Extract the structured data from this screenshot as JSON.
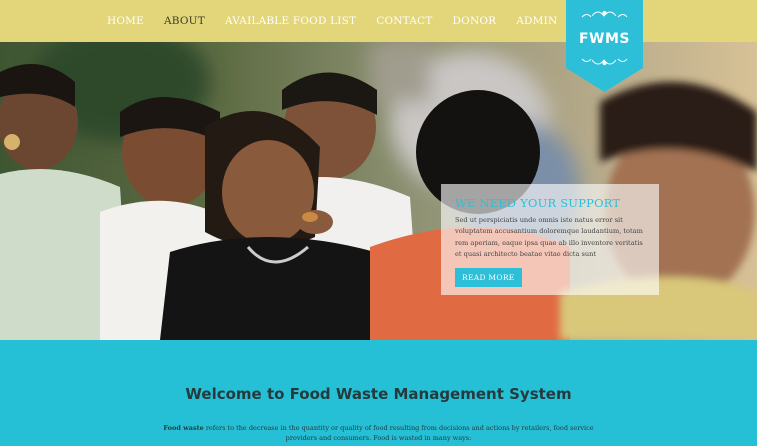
{
  "nav": {
    "items": [
      {
        "label": "HOME",
        "active": false
      },
      {
        "label": "ABOUT",
        "active": true
      },
      {
        "label": "AVAILABLE FOOD LIST",
        "active": false
      },
      {
        "label": "CONTACT",
        "active": false
      },
      {
        "label": "DONOR",
        "active": false
      },
      {
        "label": "ADMIN",
        "active": false
      }
    ]
  },
  "logo": {
    "text": "FWMS"
  },
  "hero": {
    "support": {
      "title": "WE NEED YOUR SUPPORT",
      "text": "Sed ut perspiciatis unde omnis iste natus error sit voluptatem accusantium doloremque laudantium, totam rem aperiam, eaque ipsa quae ab illo inventore veritatis et quasi architecto beatae vitae dicta sunt",
      "button_label": "READ MORE"
    }
  },
  "welcome": {
    "title": "Welcome to Food Waste Management System",
    "desc_bold": "Food waste",
    "desc_rest": " refers to the decrease in the quantity or quality of food resulting from decisions and actions by retailers, food service providers and consumers.  Food is wasted in many ways:"
  },
  "colors": {
    "nav_bg": "#e3d57a",
    "accent": "#2dbfd8",
    "section_bg": "#26c0d6",
    "heading": "#243a3d"
  }
}
